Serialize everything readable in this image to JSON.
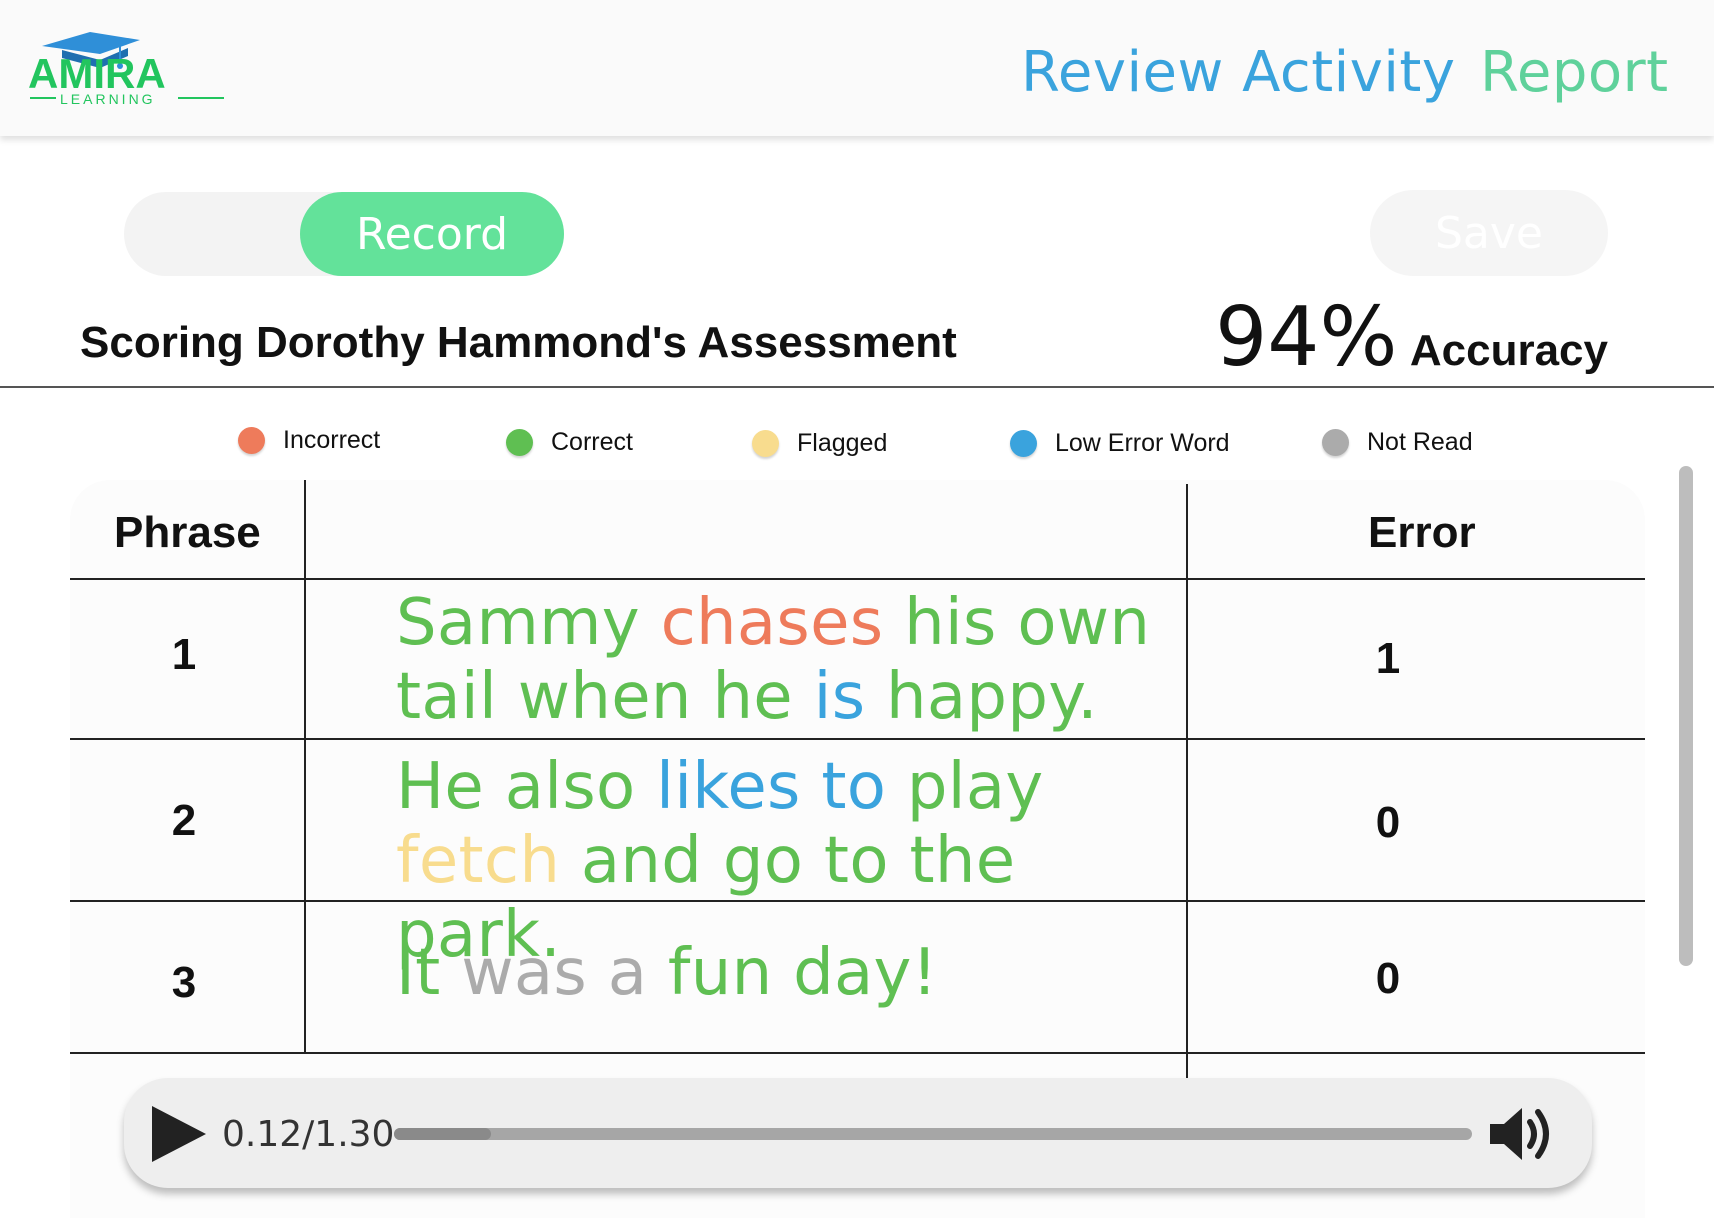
{
  "header": {
    "logo": {
      "wordmark": "AMIRA",
      "subtitle": "LEARNING",
      "icon": "graduation-cap-icon"
    },
    "nav": {
      "review_label": "Review Activity",
      "report_label": "Report"
    }
  },
  "controls": {
    "record_label": "Record",
    "save_label": "Save"
  },
  "assessment": {
    "title": "Scoring Dorothy Hammond's Assessment",
    "accuracy_value": "94%",
    "accuracy_label": "Accuracy"
  },
  "legend": [
    {
      "label": "Incorrect",
      "color": "#ee7b5b"
    },
    {
      "label": "Correct",
      "color": "#5fbf52"
    },
    {
      "label": "Flagged",
      "color": "#f8dc8e"
    },
    {
      "label": "Low Error Word",
      "color": "#3aa3dd"
    },
    {
      "label": "Not Read",
      "color": "#ababab"
    }
  ],
  "colors": {
    "incorrect": "#ee7b5b",
    "correct": "#5fbf52",
    "flagged": "#f8dc8e",
    "low_error": "#3aa3dd",
    "not_read": "#ababab",
    "record_toggle": "#63e29a",
    "nav_review": "#3aa3dd",
    "nav_report": "#5fd19b",
    "logo_blue": "#2f8fd8",
    "logo_green": "#22c55e"
  },
  "table": {
    "headers": {
      "phrase": "Phrase",
      "text": "",
      "error": "Error"
    },
    "rows": [
      {
        "number": "1",
        "error": "1",
        "words": [
          {
            "text": "Sammy",
            "status": "correct"
          },
          {
            "text": "chases",
            "status": "incorrect"
          },
          {
            "text": "his",
            "status": "correct"
          },
          {
            "text": "own",
            "status": "correct"
          },
          {
            "text": "tail",
            "status": "correct"
          },
          {
            "text": "when",
            "status": "correct"
          },
          {
            "text": "he",
            "status": "correct"
          },
          {
            "text": "is",
            "status": "low_error"
          },
          {
            "text": "happy.",
            "status": "correct"
          }
        ]
      },
      {
        "number": "2",
        "error": "0",
        "words": [
          {
            "text": "He",
            "status": "correct"
          },
          {
            "text": "also",
            "status": "correct"
          },
          {
            "text": "likes",
            "status": "low_error"
          },
          {
            "text": "to",
            "status": "low_error"
          },
          {
            "text": "play",
            "status": "correct"
          },
          {
            "text": "fetch",
            "status": "flagged"
          },
          {
            "text": "and",
            "status": "correct"
          },
          {
            "text": "go",
            "status": "correct"
          },
          {
            "text": "to",
            "status": "correct"
          },
          {
            "text": "the",
            "status": "correct"
          },
          {
            "text": "park.",
            "status": "correct"
          }
        ]
      },
      {
        "number": "3",
        "error": "0",
        "words": [
          {
            "text": "It",
            "status": "correct"
          },
          {
            "text": "was",
            "status": "not_read"
          },
          {
            "text": "a",
            "status": "not_read"
          },
          {
            "text": "fun",
            "status": "correct"
          },
          {
            "text": "day!",
            "status": "correct"
          }
        ]
      }
    ]
  },
  "player": {
    "time": "0.12/1.30",
    "progress": 0.09,
    "play_icon": "play-icon",
    "volume_icon": "volume-icon"
  }
}
